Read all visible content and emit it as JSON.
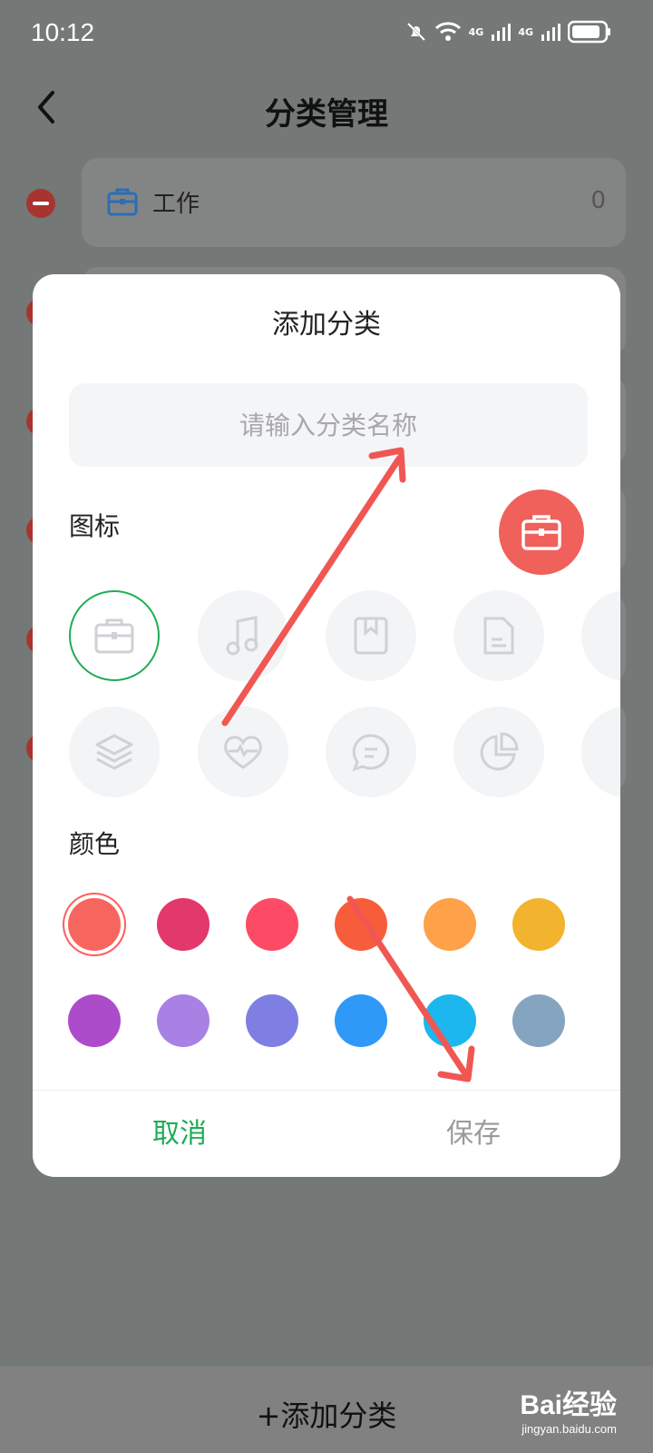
{
  "status_bar": {
    "time": "10:12",
    "network_1": "4G",
    "network_2": "4G"
  },
  "header": {
    "title": "分类管理"
  },
  "background_list": {
    "items": [
      {
        "label": "工作",
        "count": "0"
      }
    ]
  },
  "dialog": {
    "title": "添加分类",
    "name_input": {
      "placeholder": "请输入分类名称",
      "value": ""
    },
    "icon_section_label": "图标",
    "icons_row1": [
      "briefcase-icon",
      "music-icon",
      "bookmark-icon",
      "document-icon"
    ],
    "icons_row2": [
      "layers-icon",
      "heart-pulse-icon",
      "chat-icon",
      "pie-chart-icon"
    ],
    "color_section_label": "颜色",
    "colors": [
      "#f7665e",
      "#e2386b",
      "#fd4b66",
      "#f85d3b",
      "#fea148",
      "#f2b42e",
      "#ac4cca",
      "#a981e4",
      "#7f7ee2",
      "#2f99f8",
      "#1cb7ee",
      "#85a4bf"
    ],
    "selected_color": "#f7665e",
    "cancel_label": "取消",
    "save_label": "保存"
  },
  "bottom": {
    "add_label": "+添加分类"
  },
  "watermark": {
    "brand": "Bai经验",
    "url": "jingyan.baidu.com"
  }
}
